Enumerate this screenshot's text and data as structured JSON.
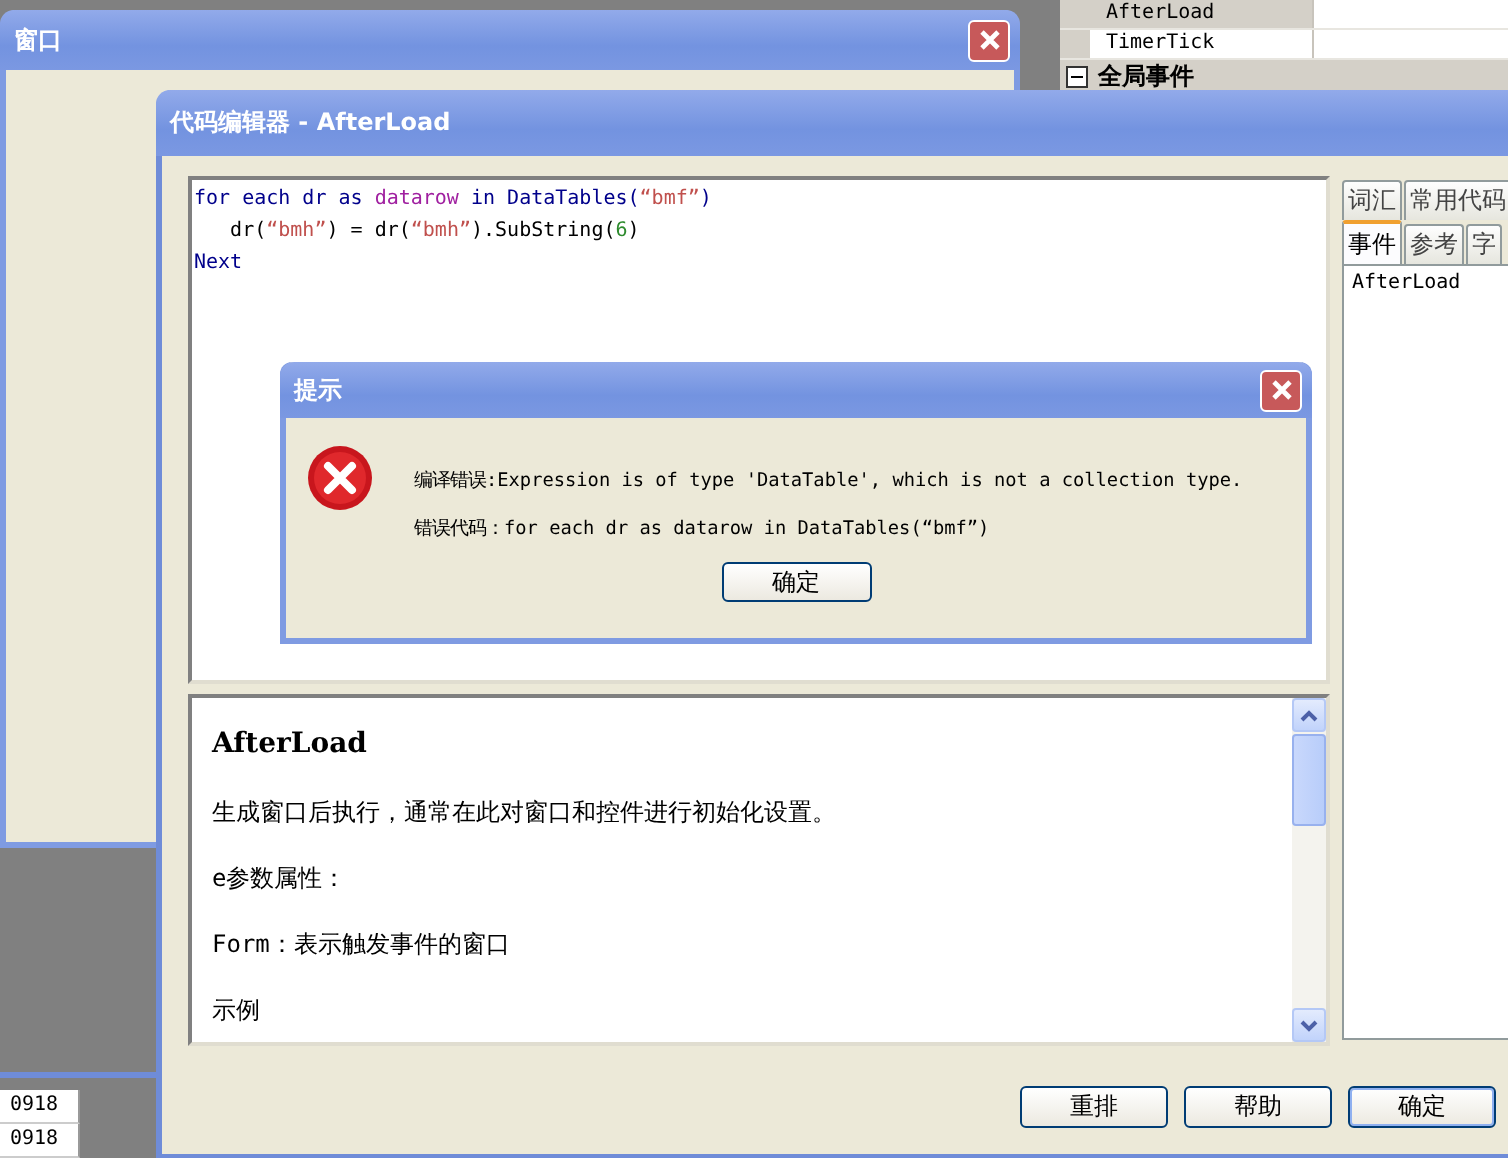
{
  "property_panel": {
    "rows": [
      {
        "name": "AfterLoad",
        "selected": true
      },
      {
        "name": "TimerTick",
        "selected": false
      }
    ],
    "group": {
      "label": "全局事件",
      "expanded": true
    }
  },
  "background_window": {
    "title": "窗口"
  },
  "background_table": {
    "rows": [
      "0918",
      "0918"
    ]
  },
  "code_editor": {
    "title": "代码编辑器 - AfterLoad",
    "code_lines": [
      [
        {
          "text": "for each dr as ",
          "kind": "keyword"
        },
        {
          "text": "datarow",
          "kind": "type"
        },
        {
          "text": " in DataTables(",
          "kind": "keyword"
        },
        {
          "text": "“bmf”",
          "kind": "string"
        },
        {
          "text": ")",
          "kind": "keyword"
        }
      ],
      [
        {
          "text": "   dr(",
          "kind": "plain"
        },
        {
          "text": "“bmh”",
          "kind": "string"
        },
        {
          "text": ") = dr(",
          "kind": "plain"
        },
        {
          "text": "“bmh”",
          "kind": "string"
        },
        {
          "text": ").SubString(",
          "kind": "plain"
        },
        {
          "text": "6",
          "kind": "number"
        },
        {
          "text": ")",
          "kind": "plain"
        }
      ],
      [
        {
          "text": "Next",
          "kind": "keyword"
        }
      ]
    ],
    "tab_rows": [
      [
        {
          "label": "词汇",
          "selected": false
        },
        {
          "label": "常用代码",
          "selected": false
        }
      ],
      [
        {
          "label": "事件",
          "selected": true
        },
        {
          "label": "参考",
          "selected": false
        },
        {
          "label": "字",
          "selected": false
        }
      ]
    ],
    "event_list": [
      "AfterLoad"
    ],
    "help": {
      "heading": "AfterLoad",
      "paragraphs": [
        "生成窗口后执行，通常在此对窗口和控件进行初始化设置。",
        "e参数属性：",
        "Form：表示触发事件的窗口",
        "示例"
      ]
    },
    "buttons": [
      "重排",
      "帮助",
      "确定"
    ]
  },
  "dialog": {
    "title": "提示",
    "message": "编译错误:Expression is of type 'DataTable', which is not a collection type.",
    "error_code": "错误代码：for each dr as datarow in DataTables(“bmf”)",
    "button": "确定"
  }
}
